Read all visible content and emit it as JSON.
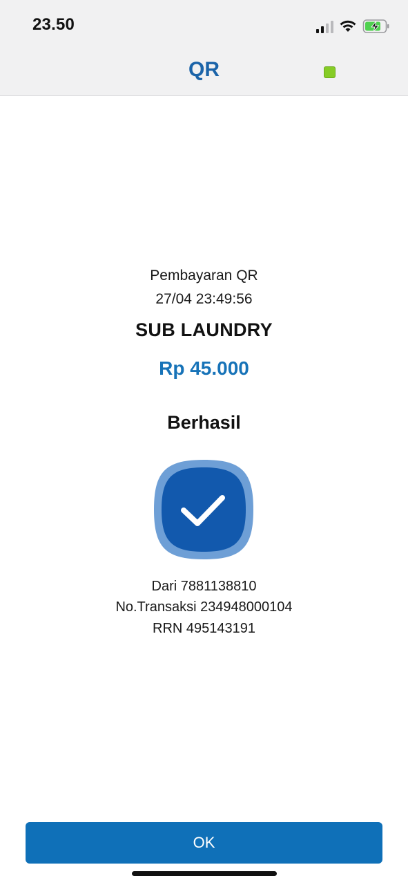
{
  "status_bar": {
    "time": "23.50",
    "signal_icon": "cellular-signal-icon",
    "wifi_icon": "wifi-icon",
    "battery_icon": "battery-charging-icon"
  },
  "header": {
    "title": "QR",
    "indicator_color": "#86cc26"
  },
  "transaction": {
    "type_label": "Pembayaran QR",
    "datetime": "27/04 23:49:56",
    "merchant": "SUB LAUNDRY",
    "amount": "Rp 45.000",
    "status": "Berhasil",
    "status_icon": "checkmark-success-icon",
    "from": "Dari 7881138810",
    "transaction_no": "No.Transaksi 234948000104",
    "rrn": "RRN 495143191"
  },
  "actions": {
    "ok_label": "OK"
  },
  "colors": {
    "accent": "#1773b8",
    "button": "#0f70b8",
    "header_bg": "#f1f1f2",
    "check_outer": "#6e9fd6",
    "check_inner": "#1259ad"
  }
}
